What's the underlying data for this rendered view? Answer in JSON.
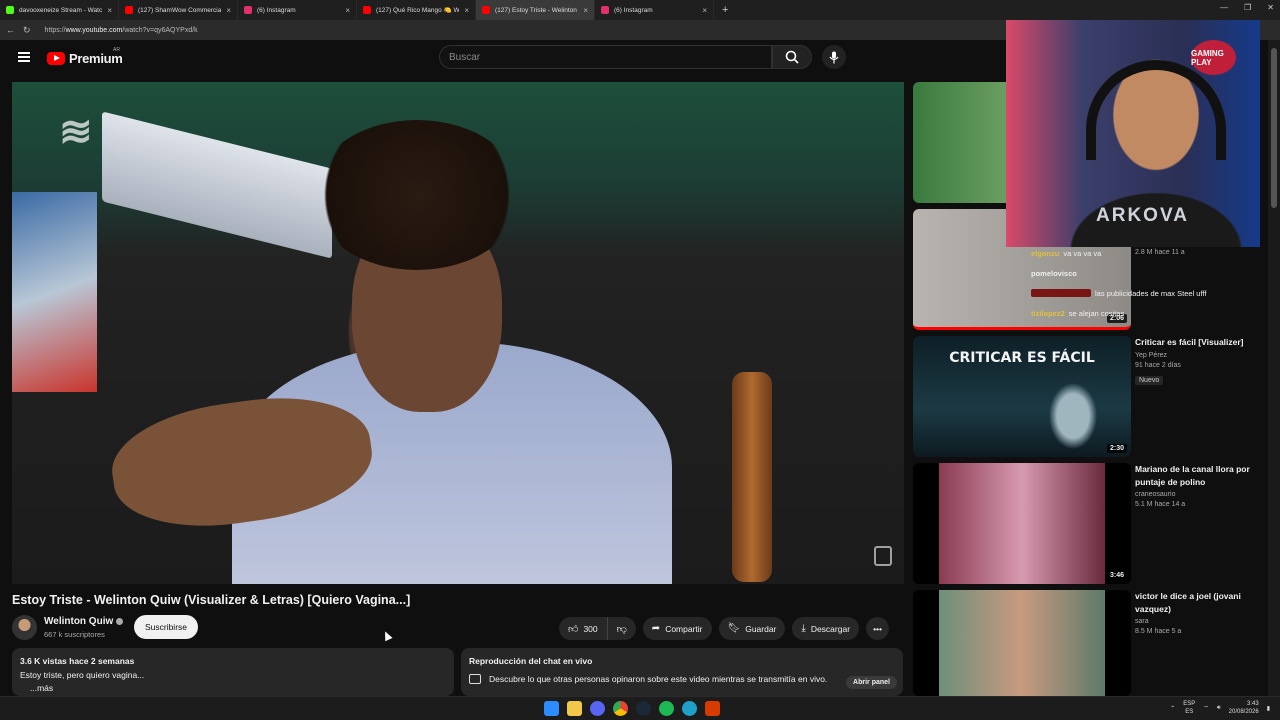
{
  "browser": {
    "tabs": [
      {
        "label": "davooxeneize Stream - Watch",
        "color": "#53fc18",
        "active": false
      },
      {
        "label": "(127) ShamWow Commercial (Spo",
        "color": "#ff0000",
        "active": false
      },
      {
        "label": "(6) Instagram",
        "color": "#e1306c",
        "active": false
      },
      {
        "label": "(127) Qué Rico Mango 🍋 Welint",
        "color": "#ff0000",
        "active": false
      },
      {
        "label": "(127) Estoy Triste - Welinton C",
        "color": "#ff0000",
        "active": true
      },
      {
        "label": "(6) Instagram",
        "color": "#e1306c",
        "active": false
      }
    ],
    "url_prefix": "https://",
    "url_host": "www.youtube.com",
    "url_path": "/watch?v=qy6AQYPxd/k"
  },
  "header": {
    "brand": "Premium",
    "country": "AR",
    "search_placeholder": "Buscar"
  },
  "video": {
    "title": "Estoy Triste - Welinton Quiw (Visualizer & Letras) [Quiero Vagina...]",
    "channel": "Welinton Quiw",
    "subscribers": "667 k suscriptores",
    "subscribe_label": "Suscribirse",
    "likes": "300",
    "share_label": "Compartir",
    "save_label": "Guardar",
    "download_label": "Descargar"
  },
  "description": {
    "stats": "3.6 K vistas  hace 2 semanas",
    "text": "Estoy triste, pero quiero vagina...",
    "more": "...más"
  },
  "live_chat_replay": {
    "heading": "Reproducción del chat en vivo",
    "text": "Descubre lo que otras personas opinaron sobre este video mientras se transmitía en vivo.",
    "open_label": "Abrir panel"
  },
  "sidebar": [
    {
      "title": "",
      "channel": "",
      "meta": "",
      "badge": "",
      "duration": "",
      "thumb_color": "#3a7a3e"
    },
    {
      "title": "",
      "channel": "",
      "meta": "2.8 M   hace 11 a",
      "badge": "",
      "duration": "2:06",
      "thumb_color": "#b9b4b0"
    },
    {
      "title": "Criticar es fácil [Visualizer]",
      "channel": "Yep Pérez",
      "meta": "91   hace 2 días",
      "badge": "Nuevo",
      "duration": "2:30",
      "thumb_text": "CRITICAR ES FÁCIL",
      "thumb_color": "#1c3a44"
    },
    {
      "title": "Mariano de la canal llora por puntaje de polino",
      "channel": "craneosaurio",
      "meta": "5.1 M   hace 14 a",
      "badge": "",
      "duration": "3:46",
      "thumb_color": "#8a3b52"
    },
    {
      "title": "victor le dice a joel (jovani vazquez)",
      "channel": "sara",
      "meta": "8.5 M   hace 5 a",
      "badge": "",
      "duration": "",
      "thumb_color": "#6e8f7a"
    }
  ],
  "stream_chat": [
    {
      "user": "elgonzu",
      "msg": "va va va va",
      "color": "#e0c040"
    },
    {
      "user": "pomelovisco",
      "msg": "",
      "color": "#f0f0f0"
    },
    {
      "user": "",
      "msg": "las publicidades de max Steel ufff",
      "color": "#ff4444"
    },
    {
      "user": "tizilopez2",
      "msg": "se alejan cositas",
      "color": "#e0c040"
    }
  ],
  "webcam": {
    "brand": "ARKOVA",
    "badge": "GAMING PLAY"
  },
  "taskbar": {
    "lang_top": "ESP",
    "lang_bottom": "ES",
    "time": "3:43",
    "date": "20/08/2026"
  }
}
